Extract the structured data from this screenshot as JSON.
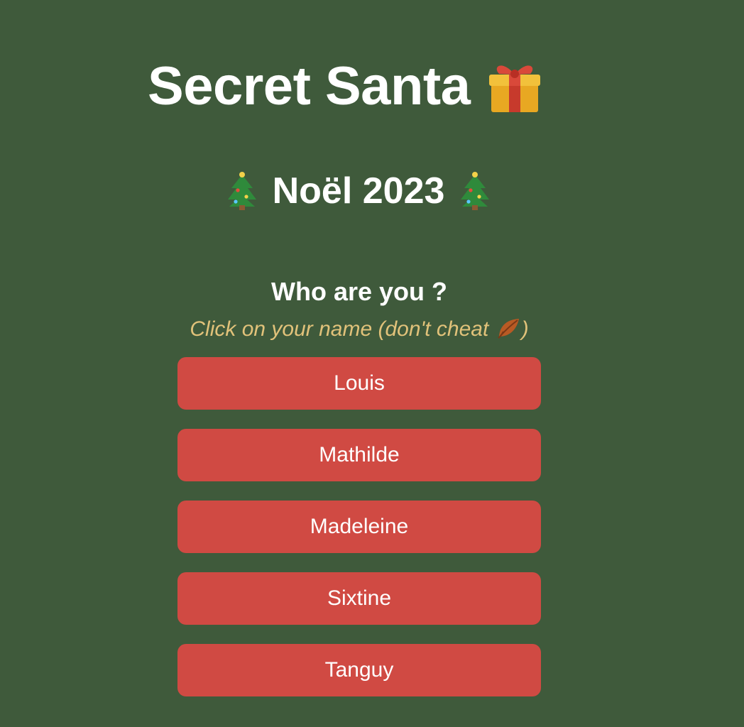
{
  "header": {
    "title": "Secret Santa",
    "title_icon": "gift-icon",
    "subtitle": "Noël 2023",
    "subtitle_icons": [
      "christmas-tree-icon",
      "christmas-tree-icon"
    ]
  },
  "prompt": {
    "question": "Who are you ?",
    "hint_prefix": "Click on your name (don't cheat ",
    "hint_suffix": ")",
    "hint_icon": "fallen-leaf-icon"
  },
  "names": [
    {
      "label": "Louis"
    },
    {
      "label": "Mathilde"
    },
    {
      "label": "Madeleine"
    },
    {
      "label": "Sixtine"
    },
    {
      "label": "Tanguy"
    }
  ],
  "colors": {
    "background": "#3f5a3b",
    "button": "#d04a43",
    "hint": "#e1c27a",
    "text": "#ffffff"
  }
}
